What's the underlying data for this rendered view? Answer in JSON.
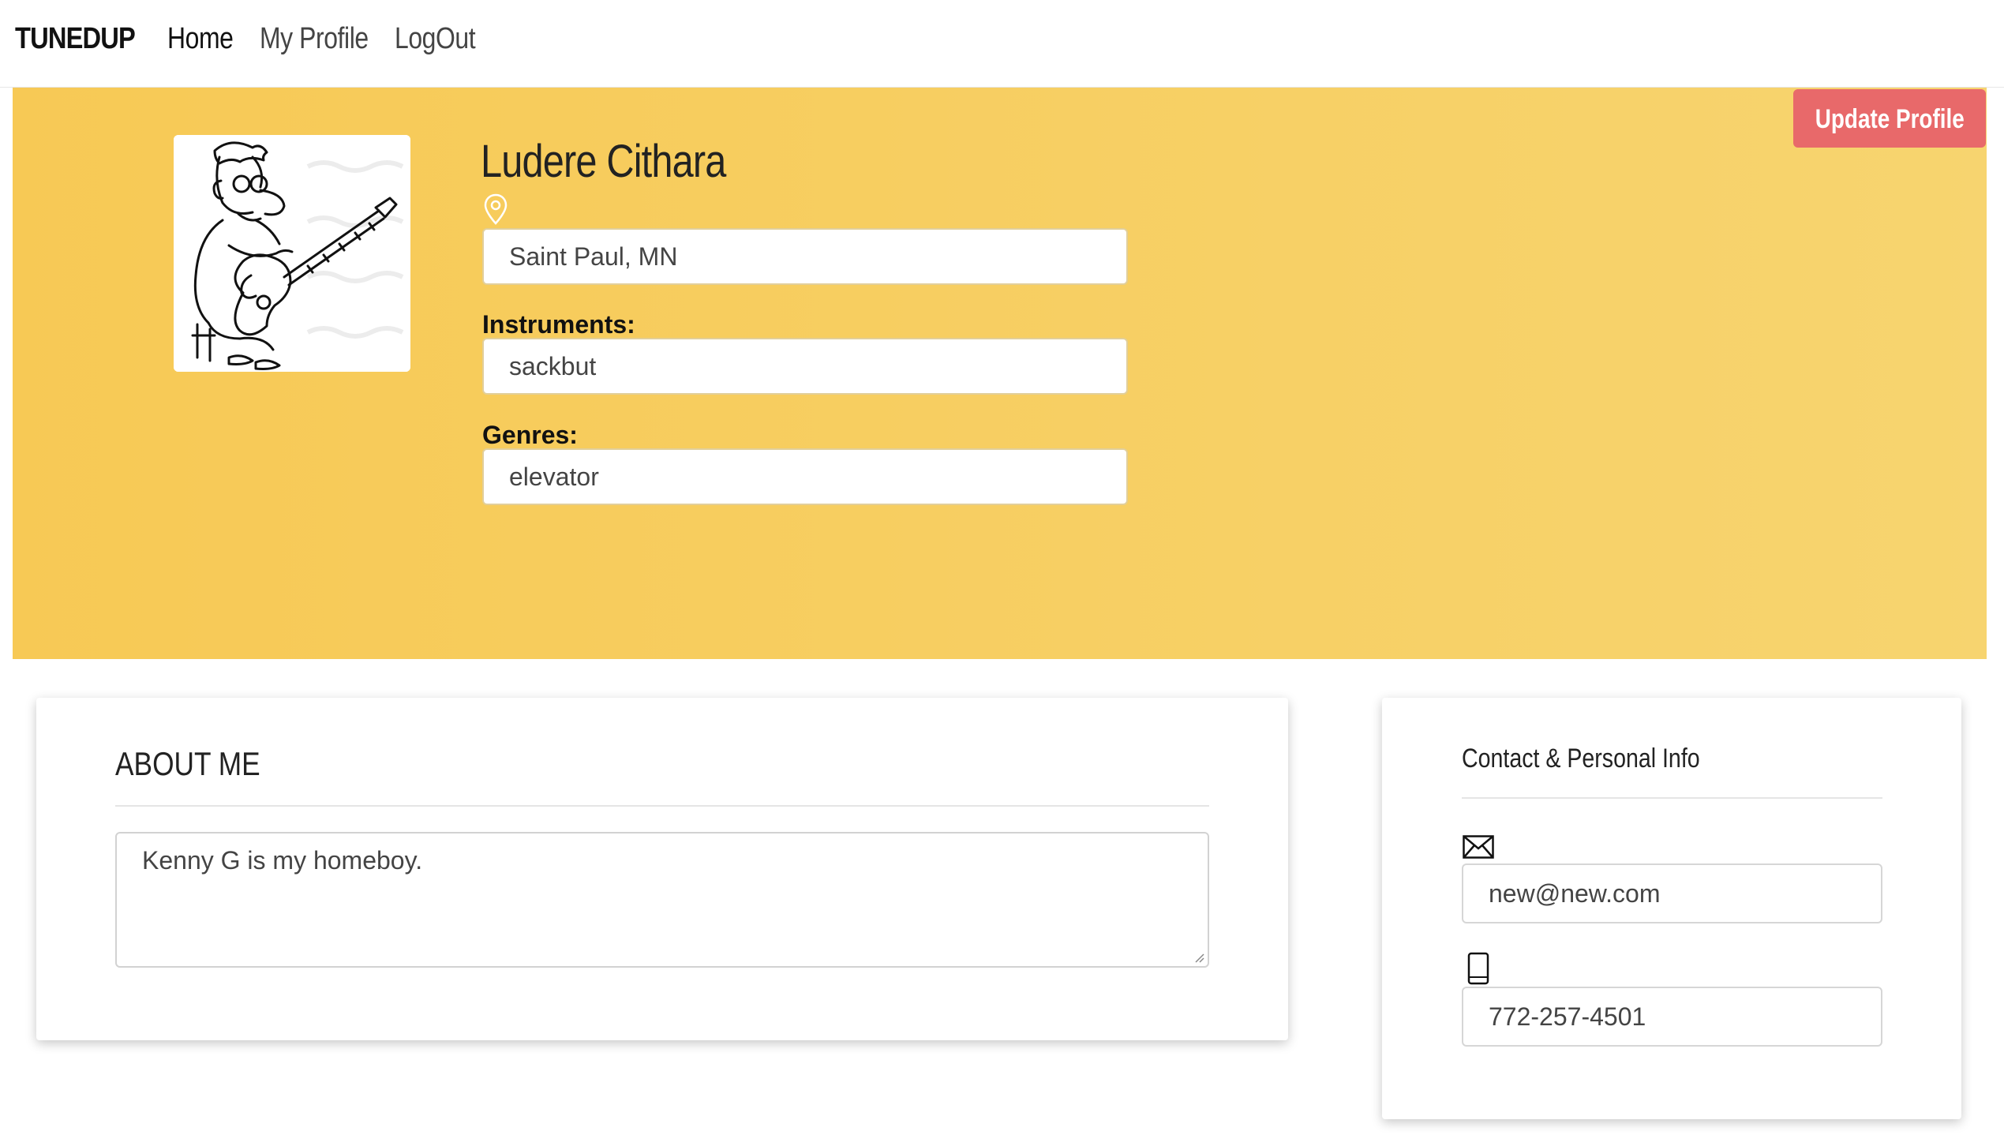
{
  "navbar": {
    "brand": "TUNEDUP",
    "links": [
      "Home",
      "My Profile",
      "LogOut"
    ]
  },
  "hero": {
    "update_button_label": "Update Profile",
    "name": "Ludere Cithara",
    "location": "Saint Paul, MN",
    "instruments_label": "Instruments:",
    "instruments_value": "sackbut",
    "genres_label": "Genres:",
    "genres_value": "elevator",
    "avatar_icon": "guitarist-cartoon",
    "location_icon": "map-pin-icon"
  },
  "about": {
    "title": "ABOUT ME",
    "text": "Kenny G is my homeboy."
  },
  "contact": {
    "title": "Contact & Personal Info",
    "email_icon": "envelope-icon",
    "email": "new@new.com",
    "phone_icon": "mobile-phone-icon",
    "phone": "772-257-4501"
  },
  "colors": {
    "hero_gradient_start": "#f7c955",
    "hero_gradient_end": "#f7d46f",
    "update_button": "#e8696a"
  }
}
